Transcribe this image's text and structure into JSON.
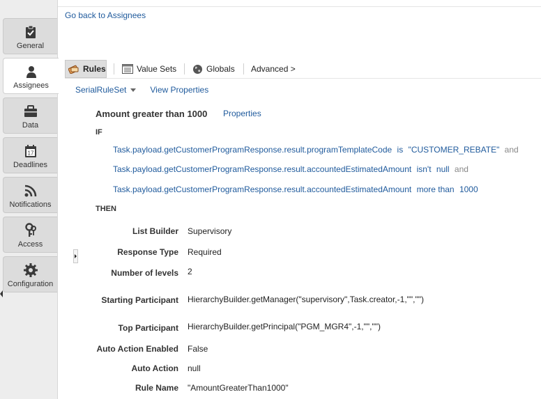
{
  "nav": {
    "tabs": [
      {
        "label": "General",
        "icon": "clipboard-check-icon"
      },
      {
        "label": "Assignees",
        "icon": "person-icon",
        "active": true
      },
      {
        "label": "Data",
        "icon": "briefcase-icon"
      },
      {
        "label": "Deadlines",
        "icon": "calendar-icon",
        "date": "17"
      },
      {
        "label": "Notifications",
        "icon": "rss-icon"
      },
      {
        "label": "Access",
        "icon": "keys-icon"
      },
      {
        "label": "Configuration",
        "icon": "gear-icon"
      }
    ]
  },
  "go_back": "Go back to Assignees",
  "toolbar": {
    "rules": "Rules",
    "value_sets": "Value Sets",
    "globals": "Globals",
    "advanced": "Advanced >"
  },
  "ruleset": {
    "name": "SerialRuleSet",
    "view_properties": "View Properties"
  },
  "rule": {
    "title": "Amount greater than 1000",
    "properties_link": "Properties",
    "if_label": "IF",
    "then_label": "THEN",
    "conditions": [
      {
        "term": "Task.payload.getCustomerProgramResponse.result.programTemplateCode",
        "op": "is",
        "value": "\"CUSTOMER_REBATE\"",
        "conj": "and"
      },
      {
        "term": "Task.payload.getCustomerProgramResponse.result.accountedEstimatedAmount",
        "op": "isn't",
        "value": "null",
        "conj": "and"
      },
      {
        "term": "Task.payload.getCustomerProgramResponse.result.accountedEstimatedAmount",
        "op": "more than",
        "value": "1000",
        "conj": ""
      }
    ],
    "actions": [
      {
        "label": "List Builder",
        "value": "Supervisory"
      },
      {
        "label": "Response Type",
        "value": "Required"
      },
      {
        "label": "Number of levels",
        "value": "2"
      },
      {
        "label": "Starting Participant",
        "value": "HierarchyBuilder.getManager(\"supervisory\",Task.creator,-1,\"\",\"\")"
      },
      {
        "label": "Top Participant",
        "value": "HierarchyBuilder.getPrincipal(\"PGM_MGR4\",-1,\"\",\"\")"
      },
      {
        "label": "Auto Action Enabled",
        "value": "False"
      },
      {
        "label": "Auto Action",
        "value": "null"
      },
      {
        "label": "Rule Name",
        "value": "\"AmountGreaterThan1000\""
      }
    ]
  }
}
